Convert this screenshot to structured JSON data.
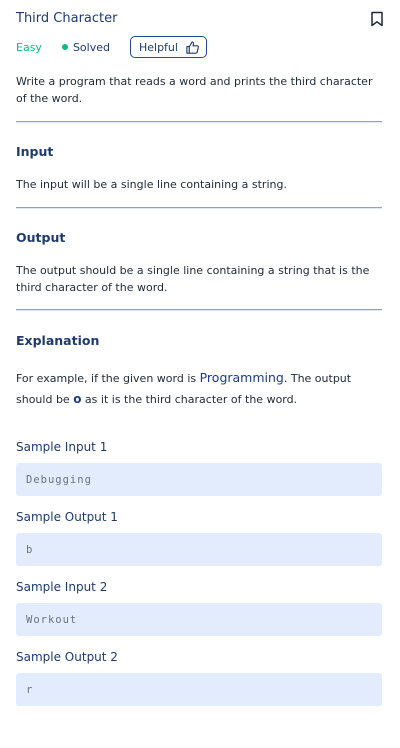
{
  "problem": {
    "title": "Third Character",
    "difficulty": "Easy",
    "status": "Solved",
    "helpful_label": "Helpful",
    "description": "Write a program that reads a word and prints the third character of the word."
  },
  "input_section": {
    "title": "Input",
    "text": "The input will be a single line containing a string."
  },
  "output_section": {
    "title": "Output",
    "text": "The output should be a single line containing a string that is the third character of the word."
  },
  "explanation": {
    "title": "Explanation",
    "part1": "For example, if the given word is ",
    "word": "Programming",
    "part2": ". The output should be ",
    "char": "o",
    "part3": " as it is the third character of the word."
  },
  "samples": [
    {
      "label": "Sample Input 1",
      "value": "Debugging"
    },
    {
      "label": "Sample Output 1",
      "value": "b"
    },
    {
      "label": "Sample Input 2",
      "value": "Workout"
    },
    {
      "label": "Sample Output 2",
      "value": "r"
    }
  ],
  "colors": {
    "accent": "#1e3a6e",
    "easy": "#10b981",
    "sample_bg": "#e3ecfd"
  },
  "icons": {
    "bookmark": "bookmark-icon",
    "thumbs_up": "thumbs-up-icon",
    "status_dot": "status-dot-icon"
  }
}
